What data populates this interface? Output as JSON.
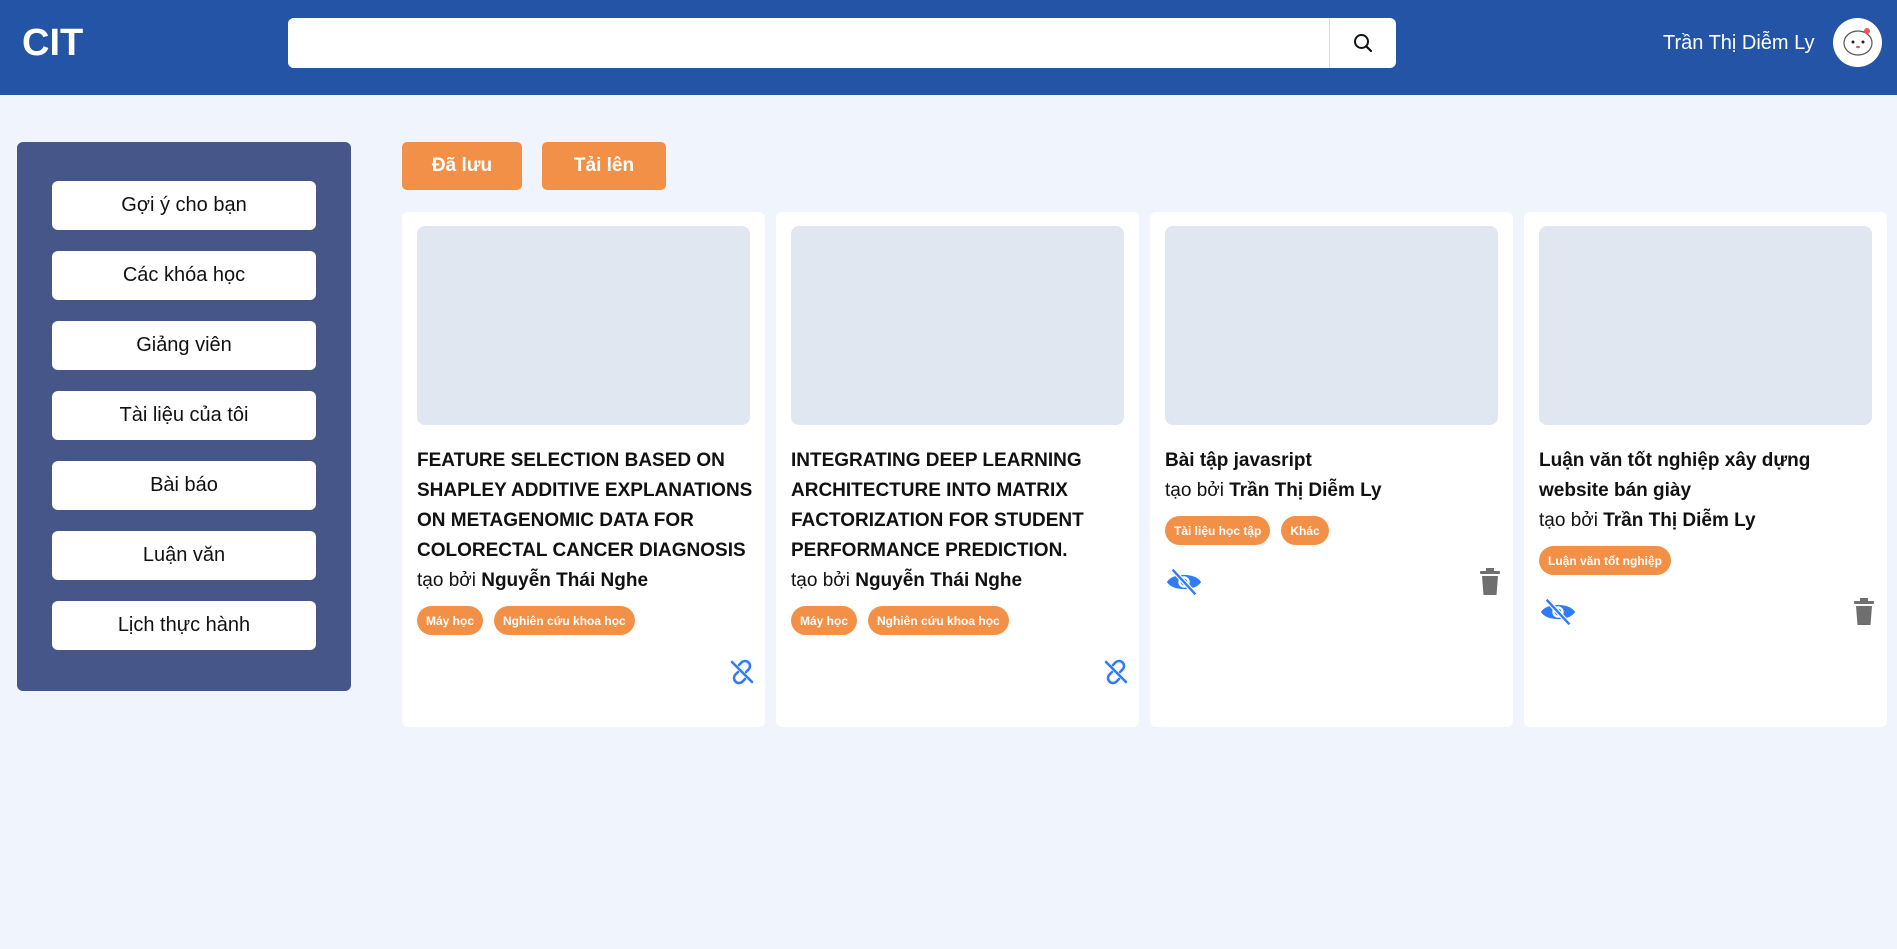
{
  "header": {
    "logo": "CIT",
    "search_value": "",
    "search_placeholder": "",
    "user_name": "Trần Thị Diễm Ly"
  },
  "sidebar": {
    "items": [
      {
        "label": "Gợi ý cho bạn"
      },
      {
        "label": "Các khóa học"
      },
      {
        "label": "Giảng viên"
      },
      {
        "label": "Tài liệu của tôi"
      },
      {
        "label": "Bài báo"
      },
      {
        "label": "Luận văn"
      },
      {
        "label": "Lịch thực hành"
      }
    ]
  },
  "toolbar": {
    "saved_label": "Đã lưu",
    "upload_label": "Tải lên"
  },
  "colors": {
    "header": "#2454a6",
    "sidebar": "#465689",
    "accent": "#f39047",
    "icon_blue": "#2f7cf6",
    "trash": "#6f6f6f"
  },
  "cards": [
    {
      "title": "FEATURE SELECTION BASED ON SHAPLEY ADDITIVE EXPLANATIONS ON METAGENOMIC DATA FOR COLORECTAL CANCER DIAGNOSIS",
      "by_prefix": "tạo bởi",
      "author": "Nguyễn Thái Nghe",
      "tags": [
        "Máy học",
        "Nghiên cứu khoa học"
      ],
      "icons": [
        "unlink-icon"
      ]
    },
    {
      "title": "INTEGRATING DEEP LEARNING ARCHITECTURE INTO MATRIX FACTORIZATION FOR STUDENT PERFORMANCE PREDICTION.",
      "by_prefix": "tạo bởi",
      "author": "Nguyễn Thái Nghe",
      "tags": [
        "Máy học",
        "Nghiên cứu khoa học"
      ],
      "icons": [
        "unlink-icon"
      ]
    },
    {
      "title": "Bài tập javasript",
      "by_prefix": "tạo bởi",
      "author": "Trần Thị Diễm Ly",
      "tags": [
        "Tài liệu học tập",
        "Khác"
      ],
      "icons": [
        "eye-slash-icon",
        "trash-icon"
      ]
    },
    {
      "title": "Luận văn tốt nghiệp xây dựng website bán giày",
      "by_prefix": "tạo bởi",
      "author": "Trần Thị Diễm Ly",
      "tags": [
        "Luận văn tốt nghiệp"
      ],
      "icons": [
        "eye-slash-icon",
        "trash-icon"
      ]
    }
  ]
}
